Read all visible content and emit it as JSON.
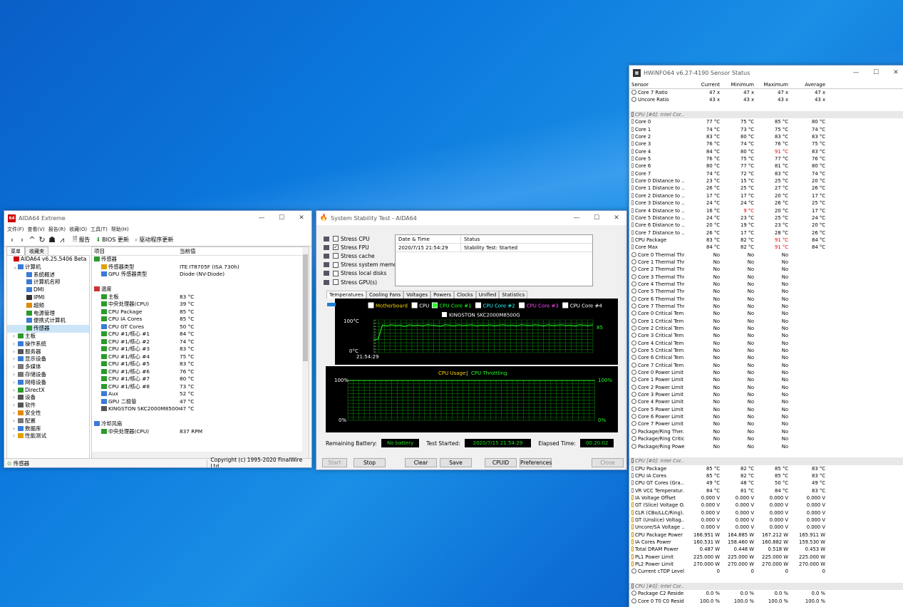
{
  "aida": {
    "title": "AIDA64 Extreme",
    "menu": [
      "文件(F)",
      "查看(V)",
      "报告(R)",
      "收藏(O)",
      "工具(T)",
      "帮助(H)"
    ],
    "toolbar": {
      "report": "报告",
      "bios": "BIOS 更新",
      "driver": "驱动程序更新"
    },
    "tabs": [
      "菜单",
      "收藏夹"
    ],
    "tree": [
      {
        "label": "AIDA64 v6.25.5406 Beta",
        "indent": 0,
        "color": "#c00"
      },
      {
        "label": "计算机",
        "indent": 1,
        "color": "#3a7bd5",
        "exp": "⌄"
      },
      {
        "label": "系统概述",
        "indent": 3,
        "color": "#3a7bd5"
      },
      {
        "label": "计算机名称",
        "indent": 3,
        "color": "#3a7bd5"
      },
      {
        "label": "DMI",
        "indent": 3,
        "color": "#3a7bd5"
      },
      {
        "label": "IPMI",
        "indent": 3,
        "color": "#333"
      },
      {
        "label": "超频",
        "indent": 3,
        "color": "#e08a00"
      },
      {
        "label": "电源管理",
        "indent": 3,
        "color": "#2a9a2a"
      },
      {
        "label": "便携式计算机",
        "indent": 3,
        "color": "#3a7bd5"
      },
      {
        "label": "传感器",
        "indent": 3,
        "color": "#2a9a2a",
        "sel": true
      },
      {
        "label": "主板",
        "indent": 1,
        "color": "#2a9a2a",
        "exp": "›"
      },
      {
        "label": "操作系统",
        "indent": 1,
        "color": "#3a7bd5",
        "exp": "›"
      },
      {
        "label": "服务器",
        "indent": 1,
        "color": "#555",
        "exp": "›"
      },
      {
        "label": "显示设备",
        "indent": 1,
        "color": "#3a7bd5",
        "exp": "›"
      },
      {
        "label": "多媒体",
        "indent": 1,
        "color": "#777",
        "exp": "›"
      },
      {
        "label": "存储设备",
        "indent": 1,
        "color": "#777",
        "exp": "›"
      },
      {
        "label": "网络设备",
        "indent": 1,
        "color": "#3a7bd5",
        "exp": "›"
      },
      {
        "label": "DirectX",
        "indent": 1,
        "color": "#2a9a2a",
        "exp": "›"
      },
      {
        "label": "设备",
        "indent": 1,
        "color": "#555",
        "exp": "›"
      },
      {
        "label": "软件",
        "indent": 1,
        "color": "#555",
        "exp": "›"
      },
      {
        "label": "安全性",
        "indent": 1,
        "color": "#e08a00",
        "exp": "›"
      },
      {
        "label": "配置",
        "indent": 1,
        "color": "#777",
        "exp": "›"
      },
      {
        "label": "数据库",
        "indent": 1,
        "color": "#3a7bd5",
        "exp": "›"
      },
      {
        "label": "性能测试",
        "indent": 1,
        "color": "#e0a000",
        "exp": "›"
      }
    ],
    "header": {
      "item": "项目",
      "value": "当前值"
    },
    "rows": [
      {
        "k": "传感器",
        "v": "",
        "lvl": 0,
        "color": "#2a9a2a"
      },
      {
        "k": "传感器类型",
        "v": "ITE IT8705F  (ISA 730h)",
        "lvl": 1,
        "color": "#e0a000"
      },
      {
        "k": "GPU 传感器类型",
        "v": "Diode  (NV-Diode)",
        "lvl": 1,
        "color": "#3a7bd5"
      },
      {
        "k": "",
        "v": "",
        "lvl": 0
      },
      {
        "k": "温度",
        "v": "",
        "lvl": 0,
        "color": "#c33"
      },
      {
        "k": "主板",
        "v": "83 °C",
        "lvl": 1,
        "color": "#2a9a2a"
      },
      {
        "k": "中央处理器(CPU)",
        "v": "39 °C",
        "lvl": 1,
        "color": "#2a9a2a"
      },
      {
        "k": "CPU Package",
        "v": "85 °C",
        "lvl": 1,
        "color": "#2a9a2a"
      },
      {
        "k": "CPU IA Cores",
        "v": "85 °C",
        "lvl": 1,
        "color": "#2a9a2a"
      },
      {
        "k": "CPU GT Cores",
        "v": "50 °C",
        "lvl": 1,
        "color": "#3a7bd5"
      },
      {
        "k": "CPU #1/核心 #1",
        "v": "84 °C",
        "lvl": 1,
        "color": "#2a9a2a"
      },
      {
        "k": "CPU #1/核心 #2",
        "v": "74 °C",
        "lvl": 1,
        "color": "#2a9a2a"
      },
      {
        "k": "CPU #1/核心 #3",
        "v": "83 °C",
        "lvl": 1,
        "color": "#2a9a2a"
      },
      {
        "k": "CPU #1/核心 #4",
        "v": "75 °C",
        "lvl": 1,
        "color": "#2a9a2a"
      },
      {
        "k": "CPU #1/核心 #5",
        "v": "83 °C",
        "lvl": 1,
        "color": "#2a9a2a"
      },
      {
        "k": "CPU #1/核心 #6",
        "v": "76 °C",
        "lvl": 1,
        "color": "#2a9a2a"
      },
      {
        "k": "CPU #1/核心 #7",
        "v": "80 °C",
        "lvl": 1,
        "color": "#2a9a2a"
      },
      {
        "k": "CPU #1/核心 #8",
        "v": "73 °C",
        "lvl": 1,
        "color": "#2a9a2a"
      },
      {
        "k": "Aux",
        "v": "52 °C",
        "lvl": 1,
        "color": "#3a7bd5"
      },
      {
        "k": "GPU 二极管",
        "v": "47 °C",
        "lvl": 1,
        "color": "#3a7bd5"
      },
      {
        "k": "KINGSTON SKC2000M8500G",
        "v": "47 °C",
        "lvl": 1,
        "color": "#555"
      },
      {
        "k": "",
        "v": "",
        "lvl": 0
      },
      {
        "k": "冷却风扇",
        "v": "",
        "lvl": 0,
        "color": "#3a7bd5"
      },
      {
        "k": "中央处理器(CPU)",
        "v": "837 RPM",
        "lvl": 1,
        "color": "#2a9a2a"
      }
    ],
    "status_left": "传感器",
    "status_right": "Copyright (c) 1995-2020 FinalWire Ltd."
  },
  "sst": {
    "title": "System Stability Test - AIDA64",
    "stress": [
      {
        "label": "Stress CPU",
        "checked": false
      },
      {
        "label": "Stress FPU",
        "checked": true
      },
      {
        "label": "Stress cache",
        "checked": false
      },
      {
        "label": "Stress system memory",
        "checked": false
      },
      {
        "label": "Stress local disks",
        "checked": false
      },
      {
        "label": "Stress GPU(s)",
        "checked": false
      }
    ],
    "log_header": {
      "date": "Date & Time",
      "status": "Status"
    },
    "log_rows": [
      {
        "date": "2020/7/15 21:54:29",
        "status": "Stability Test: Started"
      }
    ],
    "tabs": [
      "Temperatures",
      "Cooling Fans",
      "Voltages",
      "Powers",
      "Clocks",
      "Unified",
      "Statistics"
    ],
    "legend1": [
      {
        "label": "Motherboard",
        "color": "#ffd700",
        "checked": false
      },
      {
        "label": "CPU",
        "color": "#ffffff",
        "checked": false
      },
      {
        "label": "CPU Core #1",
        "color": "#22ff22",
        "checked": true
      },
      {
        "label": "CPU Core #2",
        "color": "#22ffff",
        "checked": false
      },
      {
        "label": "CPU Core #3",
        "color": "#ff44ff",
        "checked": false
      },
      {
        "label": "CPU Core #4",
        "color": "#ffffff",
        "checked": false
      }
    ],
    "legend1b": "KINGSTON SKC2000M8500G",
    "g1": {
      "ymax": "100°C",
      "ymin": "0°C",
      "time": "21:54:29",
      "current": "85",
      "series": [
        39,
        41,
        84,
        82,
        85,
        83,
        84,
        80,
        85,
        83,
        84,
        82,
        85,
        84,
        83,
        81,
        85,
        84,
        82,
        85,
        83,
        84,
        85,
        82,
        84,
        83,
        85,
        82,
        84,
        85,
        83,
        84,
        82,
        85,
        84,
        83,
        85,
        84,
        82,
        85,
        83,
        84,
        85,
        83,
        84,
        82,
        85,
        84,
        83,
        85
      ]
    },
    "g2": {
      "title_a": "CPU Usage",
      "sep": "|",
      "title_b": "CPU Throttling",
      "ymax": "100%",
      "ymin": "0%",
      "rmax": "100%",
      "rmin": "0%"
    },
    "remaining_label": "Remaining Battery:",
    "remaining": "No battery",
    "started_label": "Test Started:",
    "started": "2020/7/15 21:54:29",
    "elapsed_label": "Elapsed Time:",
    "elapsed": "00:20:02",
    "buttons": {
      "start": "Start",
      "stop": "Stop",
      "clear": "Clear",
      "save": "Save",
      "cpuid": "CPUID",
      "prefs": "Preferences",
      "close": "Close"
    }
  },
  "hw": {
    "title": "HWiNFO64 v6.27-4190 Sensor Status",
    "cols": [
      "Sensor",
      "Current",
      "Minimum",
      "Maximum",
      "Average"
    ],
    "rows": [
      [
        "Core 7 Ratio",
        "47 x",
        "47 x",
        "47 x",
        "47 x",
        "c"
      ],
      [
        "Uncore Ratio",
        "43 x",
        "43 x",
        "43 x",
        "43 x",
        "c"
      ],
      [
        "",
        "",
        "",
        "",
        "",
        ""
      ],
      [
        "CPU [#0]: Intel Cor...",
        "",
        "",
        "",
        "",
        "g"
      ],
      [
        "Core 0",
        "77 °C",
        "75 °C",
        "85 °C",
        "80 °C",
        "t"
      ],
      [
        "Core 1",
        "74 °C",
        "73 °C",
        "75 °C",
        "74 °C",
        "t"
      ],
      [
        "Core 2",
        "83 °C",
        "80 °C",
        "83 °C",
        "83 °C",
        "t"
      ],
      [
        "Core 3",
        "76 °C",
        "74 °C",
        "76 °C",
        "75 °C",
        "t"
      ],
      [
        "Core 4",
        "84 °C",
        "80 °C",
        "91 °C",
        "83 °C",
        "t",
        "m"
      ],
      [
        "Core 5",
        "76 °C",
        "75 °C",
        "77 °C",
        "76 °C",
        "t"
      ],
      [
        "Core 6",
        "80 °C",
        "77 °C",
        "81 °C",
        "80 °C",
        "t"
      ],
      [
        "Core 7",
        "74 °C",
        "72 °C",
        "83 °C",
        "74 °C",
        "t"
      ],
      [
        "Core 0 Distance to ...",
        "23 °C",
        "15 °C",
        "25 °C",
        "20 °C",
        "t"
      ],
      [
        "Core 1 Distance to ...",
        "26 °C",
        "25 °C",
        "27 °C",
        "26 °C",
        "t"
      ],
      [
        "Core 2 Distance to ...",
        "17 °C",
        "17 °C",
        "20 °C",
        "17 °C",
        "t"
      ],
      [
        "Core 3 Distance to ...",
        "24 °C",
        "24 °C",
        "26 °C",
        "25 °C",
        "t"
      ],
      [
        "Core 4 Distance to ...",
        "16 °C",
        "9 °C",
        "20 °C",
        "17 °C",
        "t",
        "n"
      ],
      [
        "Core 5 Distance to ...",
        "24 °C",
        "23 °C",
        "25 °C",
        "24 °C",
        "t"
      ],
      [
        "Core 6 Distance to ...",
        "20 °C",
        "19 °C",
        "23 °C",
        "20 °C",
        "t"
      ],
      [
        "Core 7 Distance to ...",
        "26 °C",
        "17 °C",
        "28 °C",
        "26 °C",
        "t"
      ],
      [
        "CPU Package",
        "83 °C",
        "82 °C",
        "91 °C",
        "84 °C",
        "t",
        "m"
      ],
      [
        "Core Max",
        "84 °C",
        "82 °C",
        "91 °C",
        "84 °C",
        "t",
        "m"
      ],
      [
        "Core 0 Thermal Thr...",
        "No",
        "No",
        "No",
        "",
        "c"
      ],
      [
        "Core 1 Thermal Thr...",
        "No",
        "No",
        "No",
        "",
        "c"
      ],
      [
        "Core 2 Thermal Thr...",
        "No",
        "No",
        "No",
        "",
        "c"
      ],
      [
        "Core 3 Thermal Thr...",
        "No",
        "No",
        "No",
        "",
        "c"
      ],
      [
        "Core 4 Thermal Thr...",
        "No",
        "No",
        "No",
        "",
        "c"
      ],
      [
        "Core 5 Thermal Thr...",
        "No",
        "No",
        "No",
        "",
        "c"
      ],
      [
        "Core 6 Thermal Thr...",
        "No",
        "No",
        "No",
        "",
        "c"
      ],
      [
        "Core 7 Thermal Thr...",
        "No",
        "No",
        "No",
        "",
        "c"
      ],
      [
        "Core 0 Critical Tem...",
        "No",
        "No",
        "No",
        "",
        "c"
      ],
      [
        "Core 1 Critical Tem...",
        "No",
        "No",
        "No",
        "",
        "c"
      ],
      [
        "Core 2 Critical Tem...",
        "No",
        "No",
        "No",
        "",
        "c"
      ],
      [
        "Core 3 Critical Tem...",
        "No",
        "No",
        "No",
        "",
        "c"
      ],
      [
        "Core 4 Critical Tem...",
        "No",
        "No",
        "No",
        "",
        "c"
      ],
      [
        "Core 5 Critical Tem...",
        "No",
        "No",
        "No",
        "",
        "c"
      ],
      [
        "Core 6 Critical Tem...",
        "No",
        "No",
        "No",
        "",
        "c"
      ],
      [
        "Core 7 Critical Tem...",
        "No",
        "No",
        "No",
        "",
        "c"
      ],
      [
        "Core 0 Power Limit ...",
        "No",
        "No",
        "No",
        "",
        "c"
      ],
      [
        "Core 1 Power Limit ...",
        "No",
        "No",
        "No",
        "",
        "c"
      ],
      [
        "Core 2 Power Limit ...",
        "No",
        "No",
        "No",
        "",
        "c"
      ],
      [
        "Core 3 Power Limit ...",
        "No",
        "No",
        "No",
        "",
        "c"
      ],
      [
        "Core 4 Power Limit ...",
        "No",
        "No",
        "No",
        "",
        "c"
      ],
      [
        "Core 5 Power Limit ...",
        "No",
        "No",
        "No",
        "",
        "c"
      ],
      [
        "Core 6 Power Limit ...",
        "No",
        "No",
        "No",
        "",
        "c"
      ],
      [
        "Core 7 Power Limit ...",
        "No",
        "No",
        "No",
        "",
        "c"
      ],
      [
        "Package/Ring Ther...",
        "No",
        "No",
        "No",
        "",
        "c"
      ],
      [
        "Package/Ring Critic...",
        "No",
        "No",
        "No",
        "",
        "c"
      ],
      [
        "Package/Ring Powe...",
        "No",
        "No",
        "No",
        "",
        "c"
      ],
      [
        "",
        "",
        "",
        "",
        "",
        ""
      ],
      [
        "CPU [#0]: Intel Cor...",
        "",
        "",
        "",
        "",
        "g"
      ],
      [
        "CPU Package",
        "85 °C",
        "82 °C",
        "85 °C",
        "83 °C",
        "t"
      ],
      [
        "CPU IA Cores",
        "85 °C",
        "82 °C",
        "85 °C",
        "83 °C",
        "t"
      ],
      [
        "CPU GT Cores (Gra...",
        "49 °C",
        "48 °C",
        "50 °C",
        "49 °C",
        "t"
      ],
      [
        "VR VCC Temperatur...",
        "84 °C",
        "81 °C",
        "84 °C",
        "83 °C",
        "t"
      ],
      [
        "IA Voltage Offset",
        "0.000 V",
        "0.000 V",
        "0.000 V",
        "0.000 V",
        "v"
      ],
      [
        "GT (Slice) Voltage O...",
        "0.000 V",
        "0.000 V",
        "0.000 V",
        "0.000 V",
        "v"
      ],
      [
        "CLR (CBo/LLC/Ring)...",
        "0.000 V",
        "0.000 V",
        "0.000 V",
        "0.000 V",
        "v"
      ],
      [
        "GT (Unslice) Voltag...",
        "0.000 V",
        "0.000 V",
        "0.000 V",
        "0.000 V",
        "v"
      ],
      [
        "Uncore/SA Voltage ...",
        "0.000 V",
        "0.000 V",
        "0.000 V",
        "0.000 V",
        "v"
      ],
      [
        "CPU Package Power",
        "166.951 W",
        "164.885 W",
        "167.212 W",
        "165.911 W",
        "v"
      ],
      [
        "IA Cores Power",
        "160.531 W",
        "158.460 W",
        "160.882 W",
        "159.530 W",
        "v"
      ],
      [
        "Total DRAM Power",
        "0.487 W",
        "0.448 W",
        "0.518 W",
        "0.453 W",
        "v"
      ],
      [
        "PL1 Power Limit",
        "225.000 W",
        "225.000 W",
        "225.000 W",
        "225.000 W",
        "v"
      ],
      [
        "PL2 Power Limit",
        "270.000 W",
        "270.000 W",
        "270.000 W",
        "270.000 W",
        "v"
      ],
      [
        "Current cTDP Level",
        "0",
        "0",
        "0",
        "0",
        "c"
      ],
      [
        "",
        "",
        "",
        "",
        "",
        ""
      ],
      [
        "CPU [#0]: Intel Cor...",
        "",
        "",
        "",
        "",
        "g"
      ],
      [
        "Package C2 Reside...",
        "0.0 %",
        "0.0 %",
        "0.0 %",
        "0.0 %",
        "c"
      ],
      [
        "Core 0 T0 C0 Resid...",
        "100.0 %",
        "100.0 %",
        "100.0 %",
        "100.0 %",
        "c"
      ]
    ]
  },
  "colors": {
    "accent": "#0078d7",
    "graph_green": "#1fe01f",
    "grid": "#0a7a0a",
    "alert": "#e00000"
  }
}
